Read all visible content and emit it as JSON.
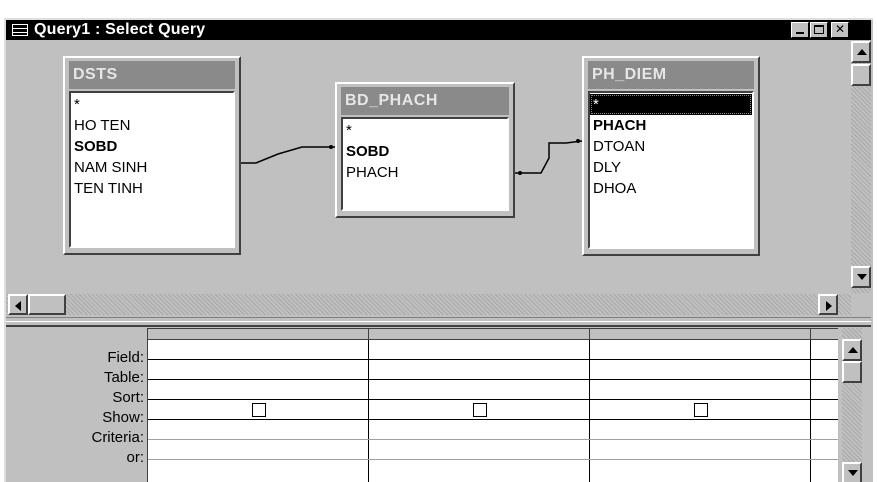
{
  "window": {
    "title": "Query1 : Select Query",
    "controls": {
      "minimize": "_",
      "maximize": "□",
      "close": "✕"
    }
  },
  "tables": [
    {
      "name": "DSTS",
      "fields": [
        {
          "label": "*",
          "bold": false
        },
        {
          "label": "HO TEN",
          "bold": false
        },
        {
          "label": "SOBD",
          "bold": true
        },
        {
          "label": "NAM SINH",
          "bold": false
        },
        {
          "label": "TEN TINH",
          "bold": false
        }
      ]
    },
    {
      "name": "BD_PHACH",
      "fields": [
        {
          "label": "*",
          "bold": false
        },
        {
          "label": "SOBD",
          "bold": true
        },
        {
          "label": "PHACH",
          "bold": false
        }
      ]
    },
    {
      "name": "PH_DIEM",
      "fields": [
        {
          "label": "*",
          "bold": false,
          "selected": true
        },
        {
          "label": "PHACH",
          "bold": true
        },
        {
          "label": "DTOAN",
          "bold": false
        },
        {
          "label": "DLY",
          "bold": false
        },
        {
          "label": "DHOA",
          "bold": false
        }
      ]
    }
  ],
  "relationships": [
    {
      "from": "DSTS.SOBD",
      "to": "BD_PHACH.SOBD"
    },
    {
      "from": "BD_PHACH.PHACH",
      "to": "PH_DIEM.PHACH"
    }
  ],
  "grid": {
    "row_labels": [
      "Field:",
      "Table:",
      "Sort:",
      "Show:",
      "Criteria:",
      "or:"
    ],
    "columns": [
      {
        "field": "",
        "table": "",
        "sort": "",
        "show": false,
        "criteria": "",
        "or": ""
      },
      {
        "field": "",
        "table": "",
        "sort": "",
        "show": false,
        "criteria": "",
        "or": ""
      },
      {
        "field": "",
        "table": "",
        "sort": "",
        "show": false,
        "criteria": "",
        "or": ""
      }
    ]
  }
}
